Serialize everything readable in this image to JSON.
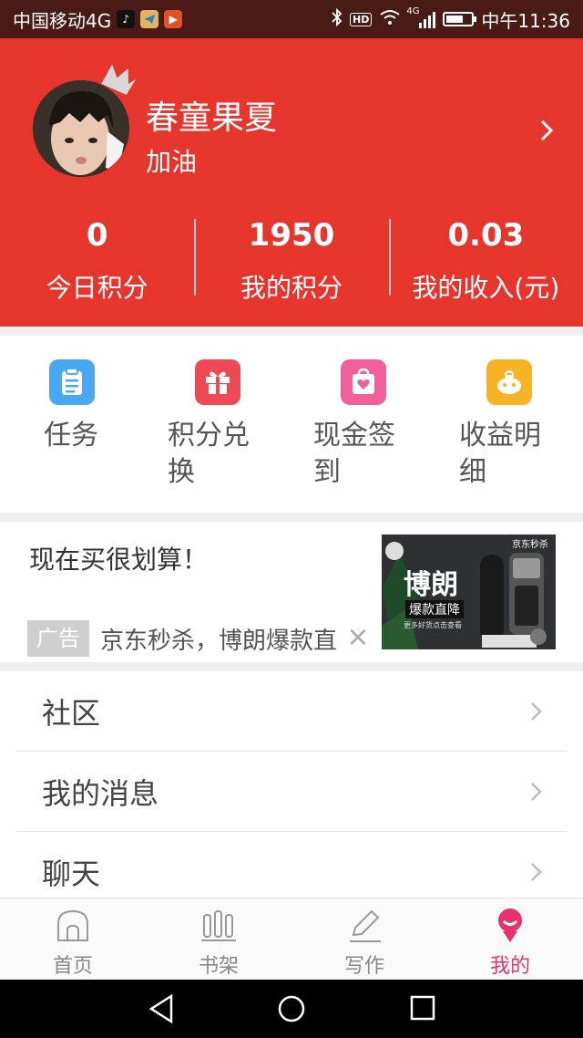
{
  "status_bar": {
    "carrier": "中国移动4G",
    "time": "中午11:36",
    "hd_label": "HD",
    "network_label": "4G",
    "battery_level": 0.7,
    "app_icons": [
      "tiktok-icon",
      "telegram-icon",
      "video-app-icon"
    ]
  },
  "profile": {
    "name": "春童果夏",
    "subtitle": "加油"
  },
  "stats": [
    {
      "value": "0",
      "label": "今日积分"
    },
    {
      "value": "1950",
      "label": "我的积分"
    },
    {
      "value": "0.03",
      "label": "我的收入(元)"
    }
  ],
  "actions": [
    {
      "label": "任务",
      "icon": "task-clipboard-icon",
      "color": "#4aa8ee"
    },
    {
      "label": "积分兑换",
      "icon": "gift-icon",
      "color": "#ee4a56"
    },
    {
      "label": "现金签到",
      "icon": "heart-bag-icon",
      "color": "#f0609a"
    },
    {
      "label": "收益明细",
      "icon": "piggy-bank-icon",
      "color": "#f5b325"
    }
  ],
  "ad": {
    "title": "现在买很划算！",
    "tag": "广告",
    "description": "京东秒杀，博朗爆款直",
    "image_brand": "京东秒杀",
    "image_title": "博朗",
    "image_subtitle": "爆款直降",
    "image_note": "更多好货点击查看"
  },
  "menu": [
    {
      "label": "社区"
    },
    {
      "label": "我的消息"
    },
    {
      "label": "聊天"
    }
  ],
  "bottom_nav": [
    {
      "label": "首页",
      "icon": "home-icon"
    },
    {
      "label": "书架",
      "icon": "bookshelf-icon"
    },
    {
      "label": "写作",
      "icon": "pencil-icon"
    },
    {
      "label": "我的",
      "icon": "profile-icon",
      "active": true
    }
  ],
  "colors": {
    "header": "#e5352d",
    "accent": "#e8336d",
    "status_bar": "#4a1a16"
  }
}
